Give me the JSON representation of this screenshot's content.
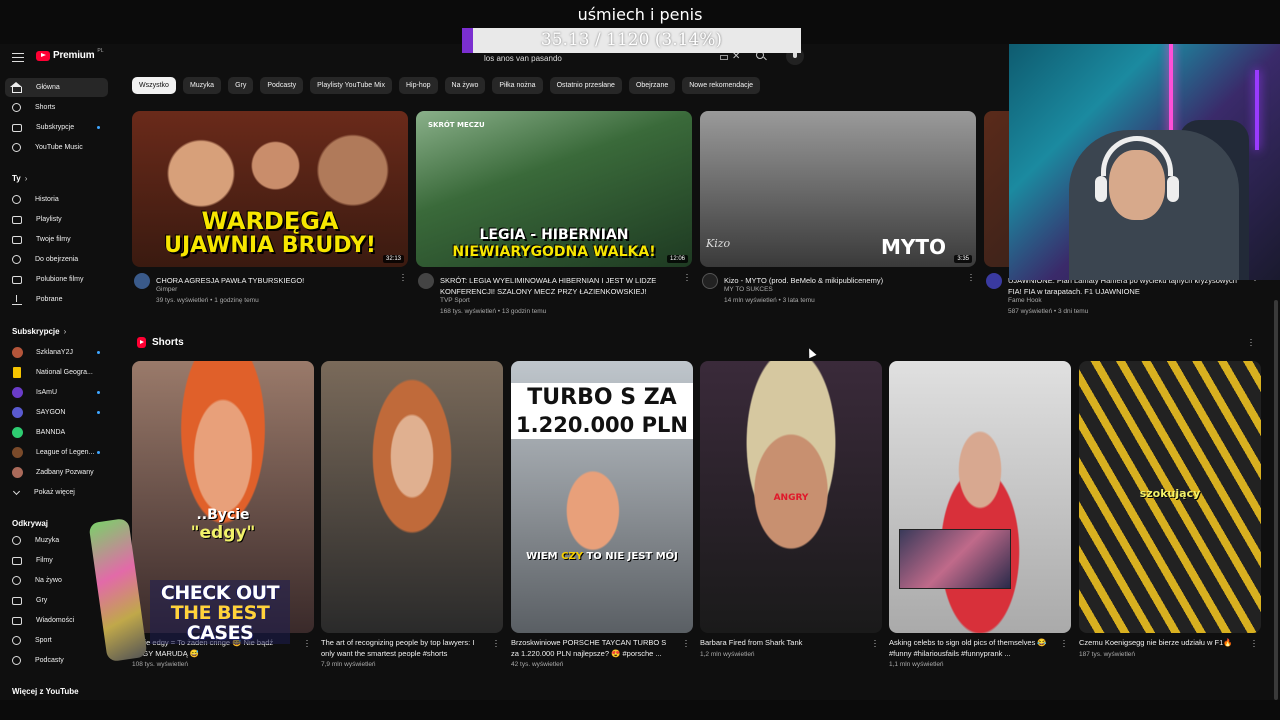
{
  "stream": {
    "title": "uśmiech i penis",
    "goal_text": "35.13 / 1120 (3.14%)",
    "goal_progress": 0.0314
  },
  "header": {
    "logo_text": "Premium",
    "logo_region": "PL",
    "search_value": "los anos van pasando",
    "icons": [
      "menu-icon",
      "keyboard-icon",
      "clear-icon",
      "search-icon",
      "mic-icon"
    ]
  },
  "sidebar": {
    "main": [
      {
        "label": "Główna",
        "icon": "home-icon",
        "active": true
      },
      {
        "label": "Shorts",
        "icon": "shorts-icon"
      },
      {
        "label": "Subskrypcje",
        "icon": "subscriptions-icon"
      },
      {
        "label": "YouTube Music",
        "icon": "music-icon"
      }
    ],
    "you_title": "Ty",
    "you": [
      {
        "label": "Historia",
        "icon": "history-icon"
      },
      {
        "label": "Playlisty",
        "icon": "playlist-icon"
      },
      {
        "label": "Twoje filmy",
        "icon": "your-videos-icon"
      },
      {
        "label": "Do obejrzenia",
        "icon": "watch-later-icon"
      },
      {
        "label": "Polubione filmy",
        "icon": "like-icon"
      },
      {
        "label": "Pobrane",
        "icon": "download-icon"
      }
    ],
    "subs_title": "Subskrypcje",
    "subs": [
      {
        "label": "SzklanaY2J",
        "color": "#b4553a",
        "dot": true
      },
      {
        "label": "National Geogra...",
        "color": "#f5c400",
        "dot": false
      },
      {
        "label": "IsAmU",
        "color": "#6a3cc8",
        "dot": true
      },
      {
        "label": "SAYGON",
        "color": "#5a5ad0",
        "dot": true
      },
      {
        "label": "BANNDA",
        "color": "#2ecc71",
        "dot": false
      },
      {
        "label": "League of Legen...",
        "color": "#7a4a2a",
        "dot": true
      },
      {
        "label": "Zadbany Pozwany",
        "color": "#aa6a5a",
        "dot": false
      },
      {
        "label": "Pokaż więcej",
        "icon": "chevron-down-icon"
      }
    ],
    "explore_title": "Odkrywaj",
    "explore": [
      {
        "label": "Muzyka",
        "icon": "music-note-icon"
      },
      {
        "label": "Filmy",
        "icon": "movies-icon"
      },
      {
        "label": "Na żywo",
        "icon": "live-icon"
      },
      {
        "label": "Gry",
        "icon": "gaming-icon"
      },
      {
        "label": "Wiadomości",
        "icon": "news-icon"
      },
      {
        "label": "Sport",
        "icon": "trophy-icon"
      },
      {
        "label": "Podcasty",
        "icon": "podcast-icon"
      }
    ],
    "more_title": "Więcej z YouTube"
  },
  "chips": [
    "Wszystko",
    "Muzyka",
    "Gry",
    "Podcasty",
    "Playlisty YouTube Mix",
    "Hip-hop",
    "Na żywo",
    "Piłka nożna",
    "Ostatnio przesłane",
    "Obejrzane",
    "Nowe rekomendacje"
  ],
  "videos": [
    {
      "title": "CHORA AGRESJA PAWŁA TYBURSKIEGO!",
      "channel": "Gimper",
      "stats": "39 tys. wyświetleń • 1 godzinę temu",
      "duration": "32:13",
      "thumb_text_1": "WARDĘGA",
      "thumb_text_2": "UJAWNIA BRUDY!",
      "thumb_color": "#6a2a1a",
      "avatar": "#3a5a8a"
    },
    {
      "title": "SKRÓT: LEGIA WYELIMINOWAŁA HIBERNIAN I JEST W LIDZE KONFERENCJI! SZALONY MECZ PRZY ŁAZIENKOWSKIEJ!",
      "channel": "TVP Sport",
      "stats": "168 tys. wyświetleń • 13 godzin temu",
      "duration": "12:06",
      "thumb_text_1": "LEGIA - HIBERNIAN",
      "thumb_text_2": "NIEWIARYGODNA WALKA!",
      "thumb_corner": "SKRÓT MECZU",
      "thumb_color": "#3a6a3a",
      "avatar": "#444"
    },
    {
      "title": "Kizo - MYTO (prod. BeMelo & mikipublicenemy)",
      "channel": "MY TO SUKCES",
      "stats": "14 mln wyświetleń • 3 lata temu",
      "duration": "3:35",
      "thumb_text_1": "MYTO",
      "thumb_sign": "Kizo",
      "thumb_color": "#5a5a5a",
      "avatar": "#222"
    },
    {
      "title": "UJAWNIONE: Plan Lamaty Hamera po wycieku tajnych kryzysowych FIA! FIA w tarapatach. F1 UJAWNIONE",
      "channel": "Fame Hook",
      "stats": "587 wyświetleń • 3 dni temu",
      "thumb_color": "#3a2a1a",
      "avatar": "#3a3aa0"
    }
  ],
  "shorts": {
    "label": "Shorts",
    "items": [
      {
        "title": "Bycie edgy = To żaden cringe 😅 Nie bądź EDGY MARUDĄ 😅",
        "views": "108 tys. wyświetleń",
        "overlay_1": "..Bycie",
        "overlay_2": "\"edgy\"",
        "color": "#7a4a3a"
      },
      {
        "title": "The art of recognizing people by top lawyers: I only want the smartest people #shorts",
        "views": "7,9 mln wyświetleń",
        "color": "#2a2a2a"
      },
      {
        "title": "Brzoskwiniowe PORSCHE TAYCAN TURBO S za 1.220.000 PLN najlepsze? 😍 #porsche ...",
        "views": "42 tys. wyświetleń",
        "overlay_1": "TURBO S ZA",
        "overlay_2": "1.220.000 PLN",
        "overlay_3": "WIEM",
        "overlay_3b": "CZY",
        "overlay_3c": "TO NIE JEST MÓJ",
        "color": "#7a7a7a"
      },
      {
        "title": "Barbara Fired from Shark Tank",
        "views": "1,2 mln wyświetleń",
        "overlay_1": "ANGRY",
        "color": "#3a2a2a"
      },
      {
        "title": "Asking celebs to sign old pics of themselves 😂 #funny #hilariousfails #funnyprank ...",
        "views": "1,1 mln wyświetleń",
        "color": "#8a8a8a"
      },
      {
        "title": "Czemu Koenigsegg nie bierze udziału w F1🔥",
        "views": "187 tys. wyświetleń",
        "overlay_1": "szokujący",
        "color": "#3a3a3a"
      }
    ]
  },
  "case_ad": {
    "line1": "CHECK OUT",
    "line2": "THE BEST",
    "line3": "CASES"
  },
  "colors": {
    "background": "#0f0f0f",
    "chip": "#272727",
    "accent_red": "#ff0033",
    "goal_fill": "#7b2fd0"
  }
}
